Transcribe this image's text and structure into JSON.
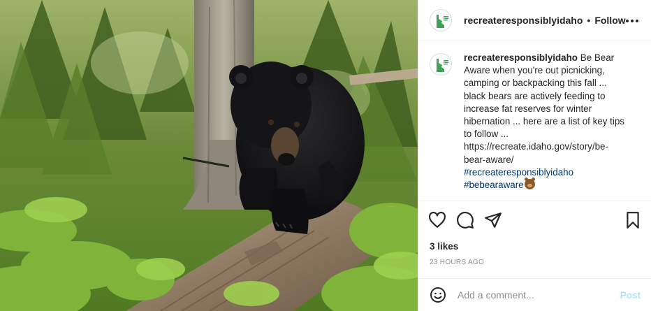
{
  "photo": {
    "subject": "black bear walking on a fallen log in a forest",
    "icon": "photo-bear"
  },
  "header": {
    "username": "recreateresponsiblyidaho",
    "separator": "•",
    "follow_label": "Follow",
    "more_icon": "more-horizontal-icon"
  },
  "caption": {
    "username": "recreateresponsiblyidaho",
    "text": "Be Bear Aware when you're out picnicking, camping or backpacking this fall ... black bears are actively feeding to increase fat reserves for winter hibernation ... here are a list of key tips to follow ... https://recreate.idaho.gov/story/be-bear-aware/",
    "hashtags": [
      "#recreateresponsiblyidaho",
      "#bebearaware"
    ],
    "trailing_emoji": "bear-face-emoji"
  },
  "actions": {
    "like_icon": "heart-icon",
    "comment_icon": "comment-bubble-icon",
    "share_icon": "paper-plane-icon",
    "save_icon": "bookmark-icon"
  },
  "likes": "3 likes",
  "timestamp": "23 HOURS AGO",
  "comment": {
    "emoji_icon": "smiley-icon",
    "placeholder": "Add a comment...",
    "post_label": "Post"
  },
  "colors": {
    "text": "#262626",
    "muted": "#8e8e8e",
    "hashtag": "#00376b",
    "post_disabled": "#b2dffc",
    "border": "#efefef"
  }
}
